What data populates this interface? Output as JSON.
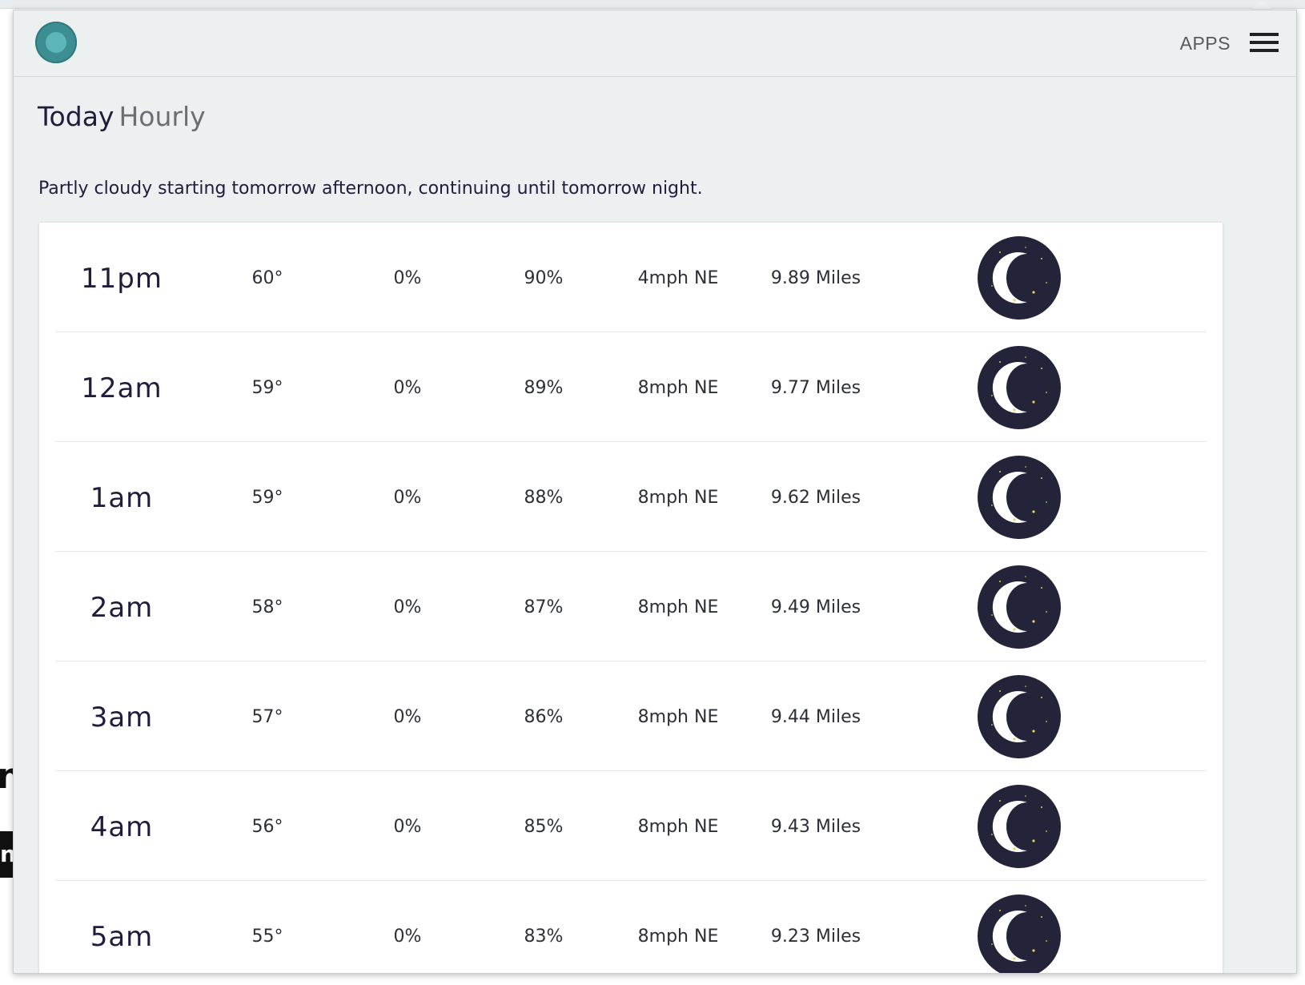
{
  "backdrop": {
    "frag_1": "n",
    "frag_2": "n"
  },
  "header": {
    "apps_label": "APPS"
  },
  "tabs": {
    "today": "Today",
    "hourly": "Hourly"
  },
  "summary": "Partly cloudy starting tomorrow afternoon, continuing until tomorrow night.",
  "rows": [
    {
      "time": "11pm",
      "temp": "60°",
      "precip": "0%",
      "humidity": "90%",
      "wind": "4mph NE",
      "visibility": "9.89 Miles",
      "icon": "clear-night-icon"
    },
    {
      "time": "12am",
      "temp": "59°",
      "precip": "0%",
      "humidity": "89%",
      "wind": "8mph NE",
      "visibility": "9.77 Miles",
      "icon": "clear-night-icon"
    },
    {
      "time": "1am",
      "temp": "59°",
      "precip": "0%",
      "humidity": "88%",
      "wind": "8mph NE",
      "visibility": "9.62 Miles",
      "icon": "clear-night-icon"
    },
    {
      "time": "2am",
      "temp": "58°",
      "precip": "0%",
      "humidity": "87%",
      "wind": "8mph NE",
      "visibility": "9.49 Miles",
      "icon": "clear-night-icon"
    },
    {
      "time": "3am",
      "temp": "57°",
      "precip": "0%",
      "humidity": "86%",
      "wind": "8mph NE",
      "visibility": "9.44 Miles",
      "icon": "clear-night-icon"
    },
    {
      "time": "4am",
      "temp": "56°",
      "precip": "0%",
      "humidity": "85%",
      "wind": "8mph NE",
      "visibility": "9.43 Miles",
      "icon": "clear-night-icon"
    },
    {
      "time": "5am",
      "temp": "55°",
      "precip": "0%",
      "humidity": "83%",
      "wind": "8mph NE",
      "visibility": "9.23 Miles",
      "icon": "clear-night-icon"
    }
  ],
  "colors": {
    "logo": "#3d8e92",
    "logo_inner": "#5cb5b7",
    "moon_disc": "#23233a",
    "moon": "#ffffff",
    "stars": "#e6d64a",
    "text_primary": "#201d3c",
    "panel_bg": "#edf0f1"
  }
}
